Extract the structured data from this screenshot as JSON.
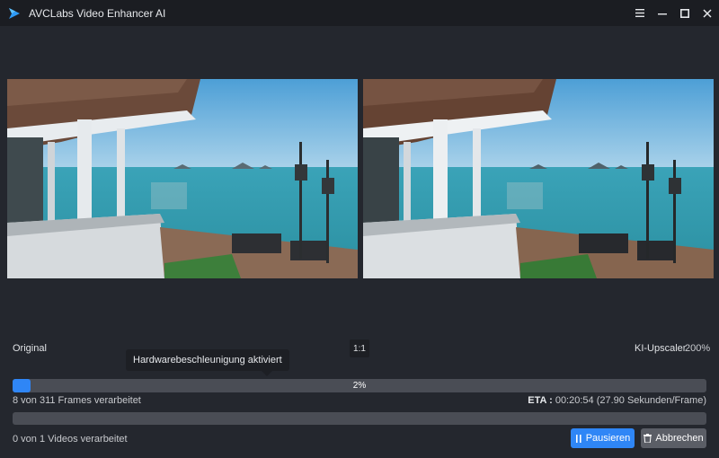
{
  "window": {
    "title": "AVCLabs Video Enhancer AI",
    "controls": [
      "menu-icon",
      "minimize-icon",
      "maximize-icon",
      "close-icon"
    ]
  },
  "preview": {
    "left_label": "Original",
    "ratio_label": "1:1",
    "right_label": "KI-Upscaler",
    "scale_label": "200%"
  },
  "tooltip": {
    "text": "Hardwarebeschleunigung aktiviert"
  },
  "progress": {
    "percent_text": "2%",
    "percent_value": 0.026,
    "frames_text": "8 von 311 Frames verarbeitet",
    "eta_label": "ETA :",
    "eta_value": " 00:20:54 (27.90 Sekunden/Frame)"
  },
  "overall": {
    "percent_value": 0,
    "videos_text": "0 von 1 Videos verarbeitet"
  },
  "buttons": {
    "pause_label": "Pausieren",
    "pause_icon": "pause-icon",
    "cancel_label": "Abbrechen",
    "cancel_icon": "trash-icon"
  },
  "colors": {
    "accent": "#2f86f6",
    "background": "#24272e",
    "titlebar": "#1b1d22"
  }
}
